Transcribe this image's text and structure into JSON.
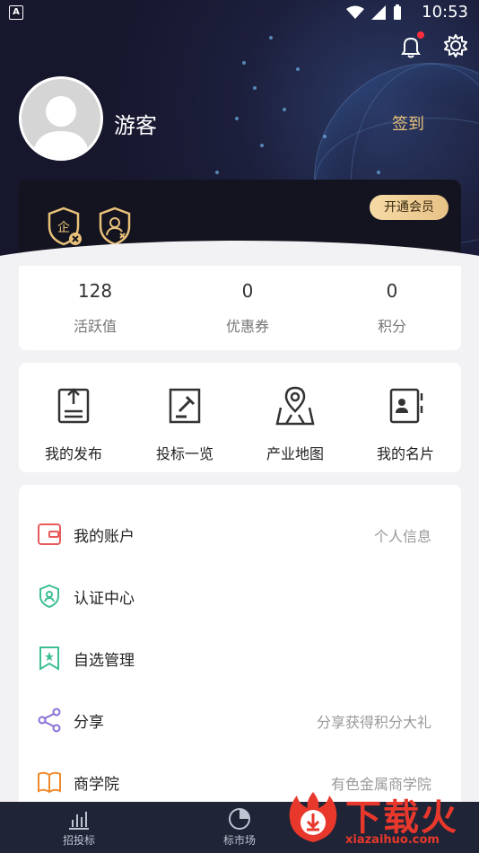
{
  "status_bar": {
    "time": "10:53",
    "left_icon": "A"
  },
  "profile": {
    "username": "游客",
    "checkin_label": "签到"
  },
  "member": {
    "vip_button": "开通会员"
  },
  "stats": [
    {
      "value": "128",
      "label": "活跃值"
    },
    {
      "value": "0",
      "label": "优惠券"
    },
    {
      "value": "0",
      "label": "积分"
    }
  ],
  "shortcuts": [
    {
      "label": "我的发布",
      "icon": "publish-icon"
    },
    {
      "label": "投标一览",
      "icon": "bid-hammer-icon"
    },
    {
      "label": "产业地图",
      "icon": "map-pin-icon"
    },
    {
      "label": "我的名片",
      "icon": "business-card-icon"
    }
  ],
  "menu": [
    {
      "label": "我的账户",
      "hint": "个人信息",
      "icon": "wallet-icon",
      "color": "#e85a5a"
    },
    {
      "label": "认证中心",
      "hint": "",
      "icon": "shield-user-icon",
      "color": "#3cbf95"
    },
    {
      "label": "自选管理",
      "hint": "",
      "icon": "bookmark-star-icon",
      "color": "#3cbf95"
    },
    {
      "label": "分享",
      "hint": "分享获得积分大礼",
      "icon": "share-icon",
      "color": "#8a6fd6"
    },
    {
      "label": "商学院",
      "hint": "有色金属商学院",
      "icon": "book-icon",
      "color": "#f08a2c"
    }
  ],
  "tabbar": [
    {
      "label": "招投标",
      "icon": "bar-chart-icon"
    },
    {
      "label": "标市场",
      "icon": "market-icon"
    }
  ],
  "watermark": {
    "text": "下载火",
    "url": "xiazaihuo.com"
  },
  "colors": {
    "header_bg": "#16162c",
    "accent_gold": "#e9c27a",
    "tabbar_bg": "#1f2436",
    "notification_dot": "#ff2d3b"
  }
}
